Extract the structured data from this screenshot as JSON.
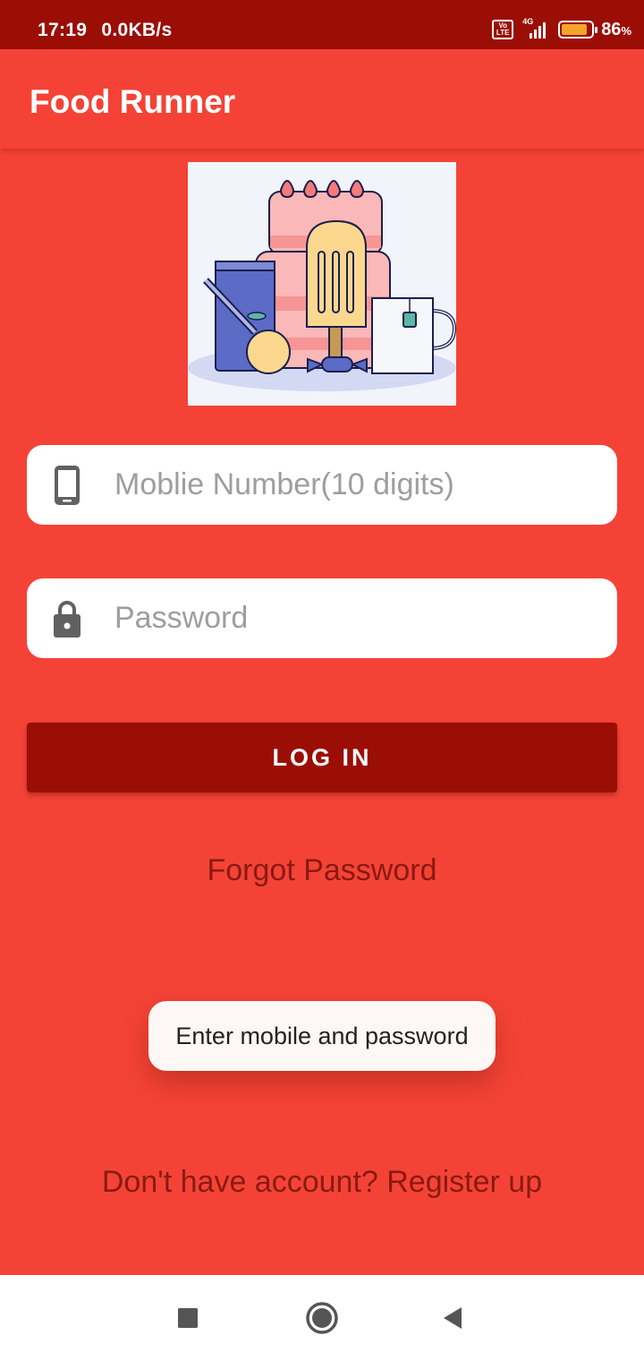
{
  "status_bar": {
    "time": "17:19",
    "net_speed": "0.0KB/s",
    "volte_top": "Vo",
    "volte_bottom": "LTE",
    "network": "4G",
    "battery_level": 86,
    "battery_text": "86",
    "battery_unit": "%"
  },
  "app_bar": {
    "title": "Food Runner"
  },
  "form": {
    "mobile_placeholder": "Moblie Number(10 digits)",
    "mobile_icon": "smartphone-icon",
    "password_placeholder": "Password",
    "password_icon": "lock-icon",
    "login_label": "LOG IN"
  },
  "links": {
    "forgot": "Forgot Password",
    "register": "Don't have account? Register up"
  },
  "toast": {
    "message": "Enter mobile and password"
  },
  "nav_bar": {
    "recents_icon": "square-icon",
    "home_icon": "circle-icon",
    "back_icon": "triangle-back-icon"
  },
  "colors": {
    "primary": "#F44336",
    "primary_dark": "#9B0E05",
    "link_text": "#8A1A12",
    "field_bg": "#FFFFFF"
  }
}
